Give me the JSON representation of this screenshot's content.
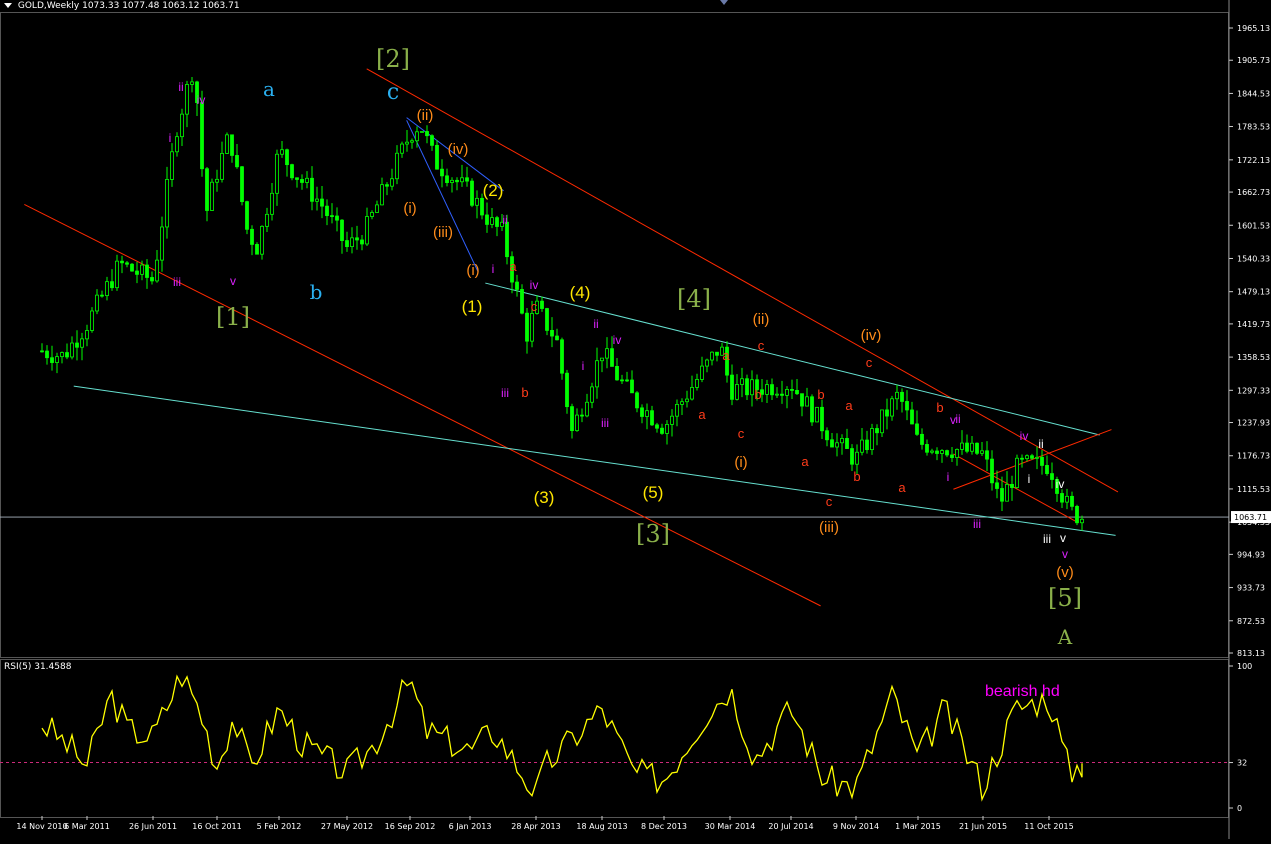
{
  "header": {
    "symbol": "GOLD,Weekly",
    "ohlc": "1073.33 1077.48 1063.12 1063.71"
  },
  "rsi_header": "RSI(5) 31.4588",
  "rsi_note": "bearish hd",
  "colors": {
    "background": "#000000",
    "candle": "#00ff00",
    "grid_line": "#ffffff",
    "channel_red": "#ff2a00",
    "channel_cyan": "#66e0d0",
    "channel_blue": "#3060ff",
    "rsi_line": "#ffff00",
    "rsi_level": "#cc2a7a",
    "label_green": "#8ab04a",
    "label_blue": "#2ab0f0",
    "label_yellow": "#ffe600",
    "label_orange": "#ff8c1a",
    "label_red": "#ff3c1a",
    "label_magenta": "#dd22ff",
    "label_white": "#ffffff"
  },
  "chart_data": [
    {
      "type": "candlestick",
      "price_axis_ticks": [
        "1965.13",
        "1905.73",
        "1844.53",
        "1783.53",
        "1722.13",
        "1662.73",
        "1601.53",
        "1540.33",
        "1479.13",
        "1419.73",
        "1358.53",
        "1297.33",
        "1237.93",
        "1176.73",
        "1115.53",
        "1054.33",
        "994.93",
        "933.73",
        "872.53",
        "813.13"
      ],
      "last_price_label": "1063.71",
      "ylim": [
        813.13,
        1965.13
      ],
      "time_axis_ticks": [
        "14 Nov 2010",
        "6 Mar 2011",
        "26 Jun 2011",
        "16 Oct 2011",
        "5 Feb 2012",
        "27 May 2012",
        "16 Sep 2012",
        "6 Jan 2013",
        "28 Apr 2013",
        "18 Aug 2013",
        "8 Dec 2013",
        "30 Mar 2014",
        "20 Jul 2014",
        "9 Nov 2014",
        "1 Mar 2015",
        "21 Jun 2015",
        "11 Oct 2015"
      ],
      "close_path": [
        [
          "14 Nov 2010",
          1370
        ],
        [
          "6 Jan 2011",
          1360
        ],
        [
          "6 Mar 2011",
          1420
        ],
        [
          "1 May 2011",
          1530
        ],
        [
          "26 Jun 2011",
          1500
        ],
        [
          "6 Aug 2011",
          1780
        ],
        [
          "6 Sep 2011",
          1900
        ],
        [
          "26 Sep 2011",
          1620
        ],
        [
          "16 Oct 2011",
          1700
        ],
        [
          "8 Nov 2011",
          1770
        ],
        [
          "10 Dec 2011",
          1590
        ],
        [
          "29 Dec 2011",
          1560
        ],
        [
          "5 Feb 2012",
          1740
        ],
        [
          "1 Mar 2012",
          1700
        ],
        [
          "15 Apr 2012",
          1640
        ],
        [
          "27 May 2012",
          1560
        ],
        [
          "28 Jun 2012",
          1590
        ],
        [
          "16 Sep 2012",
          1770
        ],
        [
          "5 Oct 2012",
          1790
        ],
        [
          "1 Nov 2012",
          1720
        ],
        [
          "6 Jan 2013",
          1660
        ],
        [
          "15 Feb 2013",
          1600
        ],
        [
          "1 Mar 2013",
          1590
        ],
        [
          "12 Apr 2013",
          1400
        ],
        [
          "28 Apr 2013",
          1450
        ],
        [
          "2 Jun 2013",
          1390
        ],
        [
          "28 Jun 2013",
          1220
        ],
        [
          "18 Aug 2013",
          1370
        ],
        [
          "10 Sep 2013",
          1330
        ],
        [
          "15 Oct 2013",
          1280
        ],
        [
          "8 Dec 2013",
          1230
        ],
        [
          "14 Mar 2014",
          1380
        ],
        [
          "30 Mar 2014",
          1300
        ],
        [
          "5 May 2014",
          1300
        ],
        [
          "20 Jul 2014",
          1310
        ],
        [
          "5 Oct 2014",
          1200
        ],
        [
          "9 Nov 2014",
          1170
        ],
        [
          "25 Jan 2015",
          1290
        ],
        [
          "1 Mar 2015",
          1200
        ],
        [
          "21 Jun 2015",
          1180
        ],
        [
          "20 Jul 2015",
          1090
        ],
        [
          "21 Aug 2015",
          1160
        ],
        [
          "11 Oct 2015",
          1160
        ],
        [
          "15 Nov 2015",
          1075
        ],
        [
          "6 Dec 2015",
          1063.71
        ]
      ],
      "wave_labels": [
        {
          "text": "ii",
          "color": "magenta"
        },
        {
          "text": "iv",
          "color": "magenta"
        },
        {
          "text": "a",
          "color": "blue"
        },
        {
          "text": "[2]",
          "color": "green"
        },
        {
          "text": "c",
          "color": "blue"
        },
        {
          "text": "i",
          "color": "magenta"
        },
        {
          "text": "iii",
          "color": "magenta"
        },
        {
          "text": "v",
          "color": "magenta"
        },
        {
          "text": "[1]",
          "color": "green"
        },
        {
          "text": "b",
          "color": "blue"
        },
        {
          "text": "(ii)",
          "color": "orange"
        },
        {
          "text": "(iv)",
          "color": "orange"
        },
        {
          "text": "(2)",
          "color": "yellow"
        },
        {
          "text": "(i)",
          "color": "orange"
        },
        {
          "text": "ii",
          "color": "magenta"
        },
        {
          "text": "(iii)",
          "color": "orange"
        },
        {
          "text": "(i)",
          "color": "orange"
        },
        {
          "text": "a",
          "color": "red"
        },
        {
          "text": "i",
          "color": "magenta"
        },
        {
          "text": "(1)",
          "color": "yellow"
        },
        {
          "text": "iv",
          "color": "magenta"
        },
        {
          "text": "(4)",
          "color": "yellow"
        },
        {
          "text": "c",
          "color": "red"
        },
        {
          "text": "[4]",
          "color": "green"
        },
        {
          "text": "ii",
          "color": "magenta"
        },
        {
          "text": "(ii)",
          "color": "orange"
        },
        {
          "text": "(iv)",
          "color": "orange"
        },
        {
          "text": "iv",
          "color": "magenta"
        },
        {
          "text": "c",
          "color": "red"
        },
        {
          "text": "i",
          "color": "magenta"
        },
        {
          "text": "a",
          "color": "red"
        },
        {
          "text": "c",
          "color": "red"
        },
        {
          "text": "iii",
          "color": "magenta"
        },
        {
          "text": "b",
          "color": "red"
        },
        {
          "text": "b",
          "color": "red"
        },
        {
          "text": "b",
          "color": "red"
        },
        {
          "text": "iii",
          "color": "magenta"
        },
        {
          "text": "a",
          "color": "red"
        },
        {
          "text": "v",
          "color": "magenta"
        },
        {
          "text": "b",
          "color": "red"
        },
        {
          "text": "c",
          "color": "red"
        },
        {
          "text": "b",
          "color": "red"
        },
        {
          "text": "a",
          "color": "red"
        },
        {
          "text": "ii",
          "color": "magenta"
        },
        {
          "text": "iv",
          "color": "magenta"
        },
        {
          "text": "ii",
          "color": "white"
        },
        {
          "text": "(i)",
          "color": "orange"
        },
        {
          "text": "a",
          "color": "red"
        },
        {
          "text": "i",
          "color": "magenta"
        },
        {
          "text": "i",
          "color": "white"
        },
        {
          "text": "iv",
          "color": "white"
        },
        {
          "text": "(3)",
          "color": "yellow"
        },
        {
          "text": "(5)",
          "color": "yellow"
        },
        {
          "text": "[3]",
          "color": "green"
        },
        {
          "text": "a",
          "color": "red"
        },
        {
          "text": "(iii)",
          "color": "orange"
        },
        {
          "text": "c",
          "color": "red"
        },
        {
          "text": "iii",
          "color": "magenta"
        },
        {
          "text": "iii",
          "color": "white"
        },
        {
          "text": "v",
          "color": "white"
        },
        {
          "text": "v",
          "color": "magenta"
        },
        {
          "text": "(v)",
          "color": "orange"
        },
        {
          "text": "[5]",
          "color": "green"
        },
        {
          "text": "A",
          "color": "green"
        }
      ]
    },
    {
      "type": "line",
      "title": "RSI(5) 31.4588",
      "ylim": [
        0,
        100
      ],
      "axis_ticks": [
        "100",
        "32",
        "0"
      ],
      "level": 32,
      "annotation": "bearish hd",
      "values_path": [
        [
          "14 Nov 2010",
          60
        ],
        [
          "Jan 2011",
          45
        ],
        [
          "6 Mar 2011",
          30
        ],
        [
          "Apr 2011",
          80
        ],
        [
          "May 2011",
          55
        ],
        [
          "26 Jun 2011",
          50
        ],
        [
          "Aug 2011",
          95
        ],
        [
          "Sep 2011",
          70
        ],
        [
          "16 Oct 2011",
          30
        ],
        [
          "Nov 2011",
          65
        ],
        [
          "Dec 2011",
          28
        ],
        [
          "5 Feb 2012",
          70
        ],
        [
          "Mar 2012",
          45
        ],
        [
          "27 May 2012",
          25
        ],
        [
          "Jul 2012",
          45
        ],
        [
          "16 Sep 2012",
          90
        ],
        [
          "Oct 2012",
          55
        ],
        [
          "6 Jan 2013",
          40
        ],
        [
          "Feb 2013",
          55
        ],
        [
          "28 Apr 2013",
          10
        ],
        [
          "May 2013",
          30
        ],
        [
          "18 Aug 2013",
          70
        ],
        [
          "Oct 2013",
          25
        ],
        [
          "8 Dec 2013",
          20
        ],
        [
          "Feb 2014",
          65
        ],
        [
          "30 Mar 2014",
          85
        ],
        [
          "May 2014",
          35
        ],
        [
          "20 Jul 2014",
          70
        ],
        [
          "Sep 2014",
          20
        ],
        [
          "9 Nov 2014",
          15
        ],
        [
          "Jan 2015",
          80
        ],
        [
          "1 Mar 2015",
          35
        ],
        [
          "Apr 2015",
          70
        ],
        [
          "21 Jun 2015",
          15
        ],
        [
          "Aug 2015",
          70
        ],
        [
          "11 Oct 2015",
          78
        ],
        [
          "Nov 2015",
          25
        ],
        [
          "6 Dec 2015",
          31.4588
        ]
      ]
    }
  ]
}
